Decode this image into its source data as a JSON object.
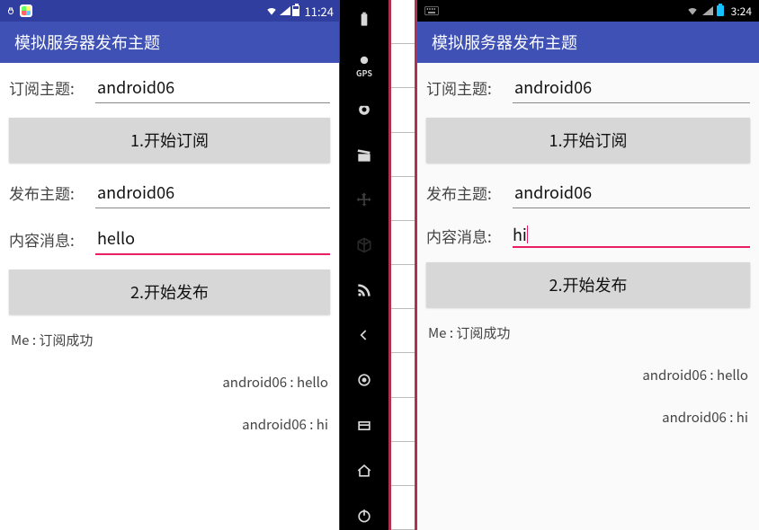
{
  "left": {
    "status": {
      "time": "11:24"
    },
    "appbar": {
      "title": "模拟服务器发布主题"
    },
    "subscribe": {
      "label": "订阅主题:",
      "value": "android06",
      "button": "1.开始订阅"
    },
    "publish": {
      "label": "发布主题:",
      "value": "android06"
    },
    "message": {
      "label": "内容消息:",
      "value": "hello"
    },
    "publish_button": "2.开始发布",
    "log": {
      "l0": "Me : 订阅成功",
      "l1": "android06 : hello",
      "l2": "android06 : hi"
    }
  },
  "right": {
    "status": {
      "time": "3:24"
    },
    "appbar": {
      "title": "模拟服务器发布主题"
    },
    "subscribe": {
      "label": "订阅主题:",
      "value": "android06",
      "button": "1.开始订阅"
    },
    "publish": {
      "label": "发布主题:",
      "value": "android06"
    },
    "message": {
      "label": "内容消息:",
      "value": "hi"
    },
    "publish_button": "2.开始发布",
    "log": {
      "l0": "Me : 订阅成功",
      "l1": "android06 : hello",
      "l2": "android06 : hi"
    }
  },
  "sidebar_icons": [
    "battery",
    "gps",
    "camera",
    "clapper",
    "move",
    "cube",
    "rss",
    "back",
    "circle-dot",
    "recent",
    "home",
    "power"
  ]
}
